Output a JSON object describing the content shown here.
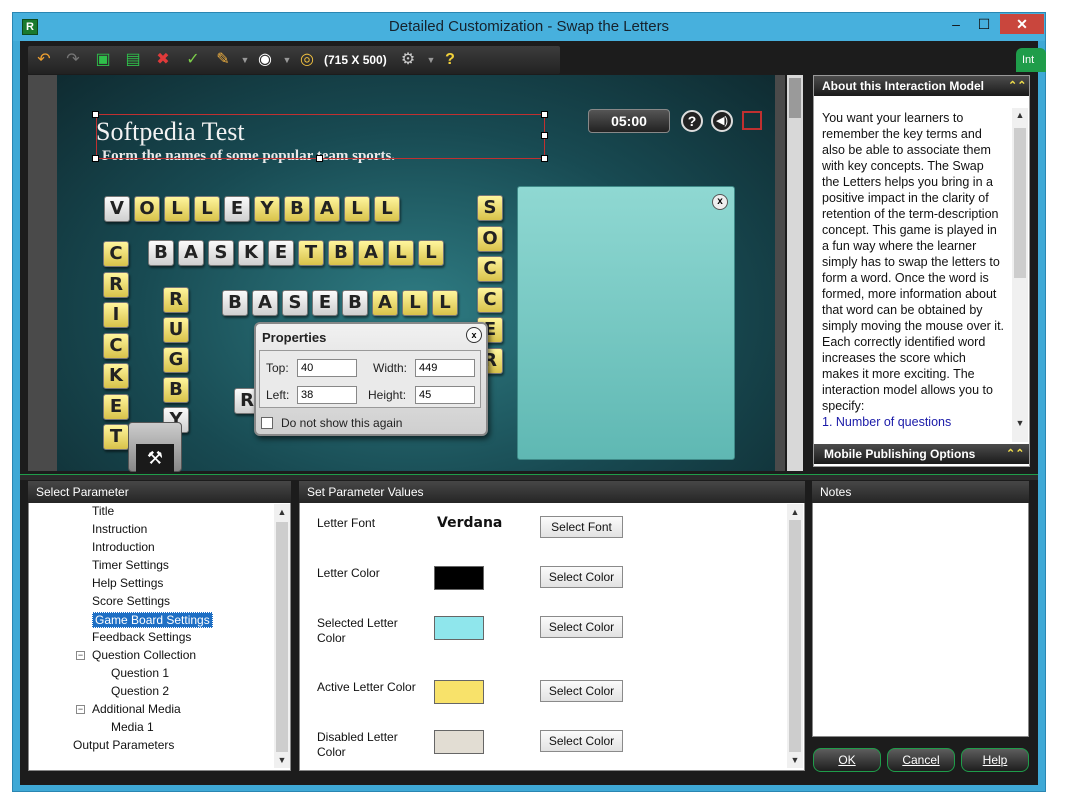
{
  "window": {
    "title": "Detailed Customization - Swap the Letters",
    "app_icon": "R",
    "minimize": "–",
    "maximize": "☐",
    "close": "✕"
  },
  "toolbar": {
    "size_label": "(715 X 500)",
    "help_glyph": "?"
  },
  "side_tab": {
    "label": "Int"
  },
  "stage": {
    "title": "Softpedia Test",
    "instruction": "Form the names of some popular team sports.",
    "timer": "05:00",
    "help_glyph": "?",
    "sound_glyph": "◀)",
    "panel_close": "x",
    "tool_glyph": "⚒"
  },
  "properties": {
    "title": "Properties",
    "close": "x",
    "top_label": "Top:",
    "top_value": "40",
    "width_label": "Width:",
    "width_value": "449",
    "left_label": "Left:",
    "left_value": "38",
    "height_label": "Height:",
    "height_value": "45",
    "checkbox_label": "Do not show this again"
  },
  "about": {
    "heading": "About this Interaction Model",
    "text": "You want your learners to remember the key terms and also be able to associate them with key concepts. The Swap the Letters helps you bring in a positive impact in the clarity of retention of the term-description concept. This game is played in a fun way where the learner simply has to swap the letters to form a word. Once the word is formed, more information about that word can be obtained by simply moving the mouse over it. Each correctly identified word increases the score which makes it more exciting. The interaction model allows you to specify:",
    "link": "1. Number of questions",
    "mobile_heading": "Mobile Publishing Options"
  },
  "select_parameter": {
    "heading": "Select Parameter",
    "items": [
      "Title",
      "Instruction",
      "Introduction",
      "Timer Settings",
      "Help Settings",
      "Score Settings",
      "Game Board Settings",
      "Feedback Settings",
      "Question Collection",
      "Question 1",
      "Question 2",
      "Additional Media",
      "Media  1",
      "Output Parameters"
    ]
  },
  "set_values": {
    "heading": "Set Parameter Values",
    "font_label": "Letter Font",
    "font_value": "Verdana",
    "select_font": "Select Font",
    "rows": [
      {
        "label": "Letter Color",
        "color": "#000000",
        "button": "Select Color"
      },
      {
        "label": "Selected Letter Color",
        "color": "#8fe6ec",
        "button": "Select Color"
      },
      {
        "label": "Active Letter Color",
        "color": "#f8e26a",
        "button": "Select Color"
      },
      {
        "label": "Disabled Letter Color",
        "color": "#e2ddd3",
        "button": "Select Color"
      }
    ]
  },
  "notes": {
    "heading": "Notes"
  },
  "dialog": {
    "ok": "OK",
    "cancel": "Cancel",
    "help": "Help"
  },
  "board": {
    "volleyball": "VOLLEYBALL",
    "basketball": "BASKETBALL",
    "baseball": "BASEBALL",
    "cricket": "CRICKET",
    "rugby": "RUGBY",
    "soccer": "SOCCER",
    "extra_tile": "R"
  },
  "colors": {
    "accent_green": "#1f9d4a",
    "title_bar": "#47b0dd",
    "selection": "#1e6fc4"
  }
}
